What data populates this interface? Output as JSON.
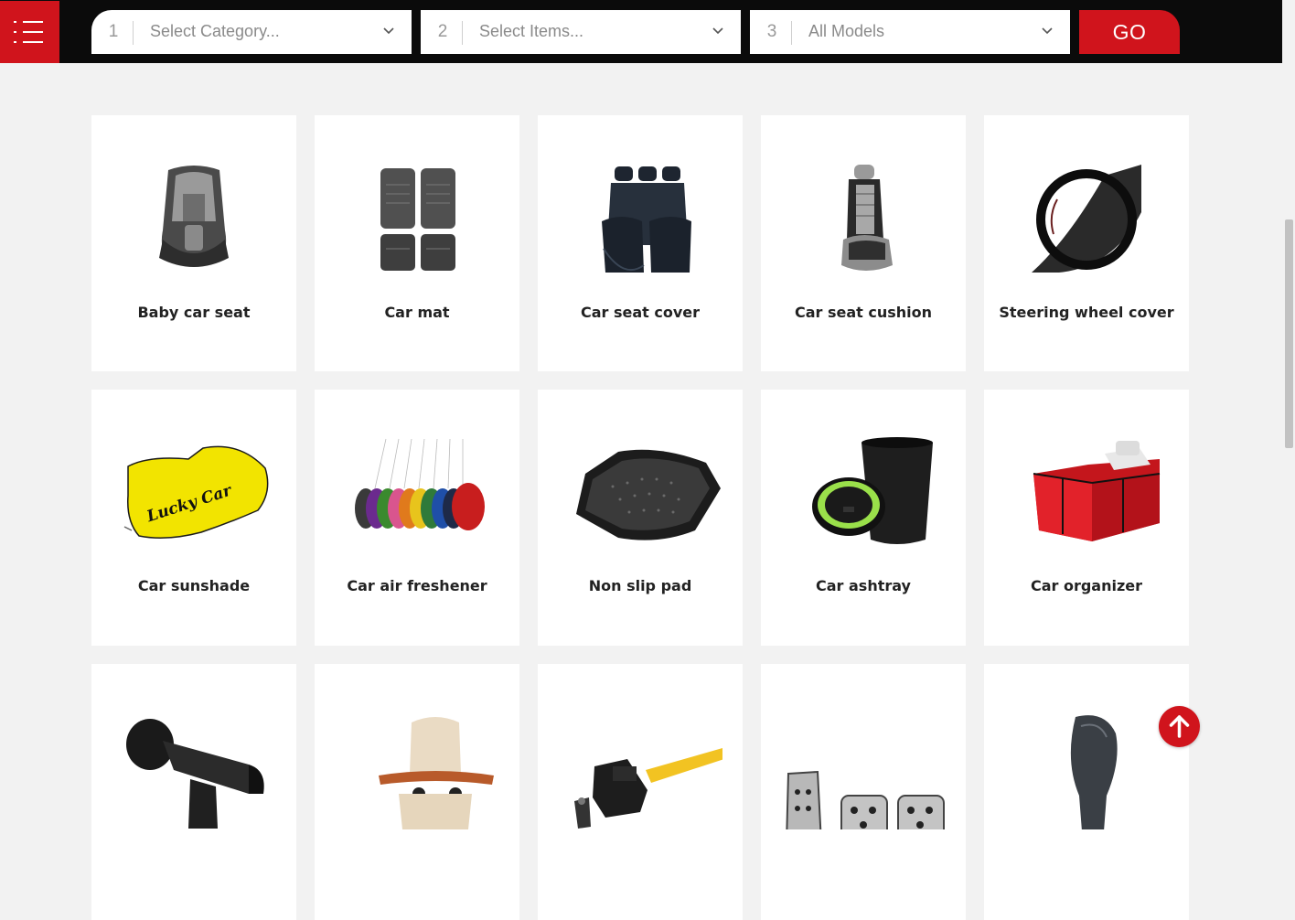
{
  "header": {
    "menu_icon": "hamburger-menu-icon",
    "selects": [
      {
        "num": "1",
        "placeholder": "Select Category..."
      },
      {
        "num": "2",
        "placeholder": "Select Items..."
      },
      {
        "num": "3",
        "placeholder": "All Models"
      }
    ],
    "go_label": "GO"
  },
  "products": [
    {
      "label": "Baby car seat",
      "icon": "baby-car-seat-icon"
    },
    {
      "label": "Car mat",
      "icon": "car-mat-icon"
    },
    {
      "label": "Car seat cover",
      "icon": "car-seat-cover-icon"
    },
    {
      "label": "Car seat cushion",
      "icon": "car-seat-cushion-icon"
    },
    {
      "label": "Steering wheel cover",
      "icon": "steering-wheel-cover-icon"
    },
    {
      "label": "Car sunshade",
      "icon": "car-sunshade-icon"
    },
    {
      "label": "Car air freshener",
      "icon": "car-air-freshener-icon"
    },
    {
      "label": "Non slip pad",
      "icon": "non-slip-pad-icon"
    },
    {
      "label": "Car ashtray",
      "icon": "car-ashtray-icon"
    },
    {
      "label": "Car organizer",
      "icon": "car-organizer-icon"
    },
    {
      "label": "",
      "icon": "phone-holder-icon"
    },
    {
      "label": "",
      "icon": "seat-hanger-icon"
    },
    {
      "label": "",
      "icon": "steering-lock-icon"
    },
    {
      "label": "",
      "icon": "pedal-cover-icon"
    },
    {
      "label": "",
      "icon": "gear-knob-cover-icon"
    }
  ],
  "sunshade_logo_text": "Lucky Car",
  "colors": {
    "accent": "#d0141c",
    "topbar": "#0b0b0b",
    "background": "#f2f2f2"
  }
}
